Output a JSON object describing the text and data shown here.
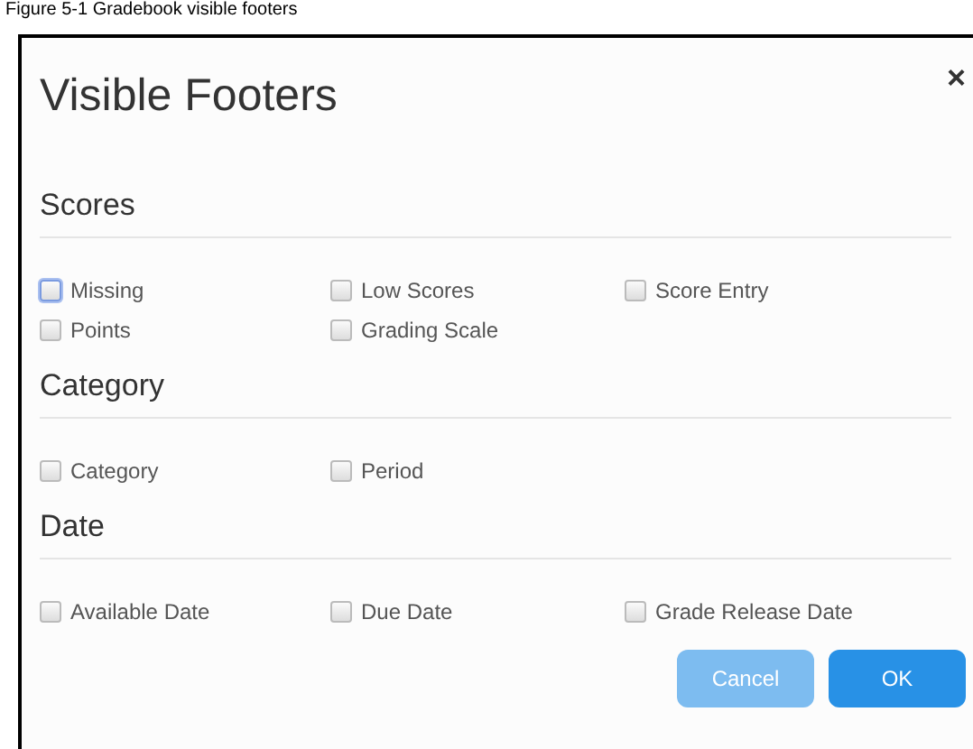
{
  "caption": "Figure 5-1 Gradebook visible footers",
  "dialog": {
    "title": "Visible Footers",
    "close": "×",
    "sections": [
      {
        "heading": "Scores",
        "options": [
          {
            "label": "Missing",
            "checked": false,
            "focused": true
          },
          {
            "label": "Low Scores",
            "checked": false,
            "focused": false
          },
          {
            "label": "Score Entry",
            "checked": false,
            "focused": false
          },
          {
            "label": "Points",
            "checked": false,
            "focused": false
          },
          {
            "label": "Grading Scale",
            "checked": false,
            "focused": false
          }
        ]
      },
      {
        "heading": "Category",
        "options": [
          {
            "label": "Category",
            "checked": false,
            "focused": false
          },
          {
            "label": "Period",
            "checked": false,
            "focused": false
          }
        ]
      },
      {
        "heading": "Date",
        "options": [
          {
            "label": "Available Date",
            "checked": false,
            "focused": false
          },
          {
            "label": "Due Date",
            "checked": false,
            "focused": false
          },
          {
            "label": "Grade Release Date",
            "checked": false,
            "focused": false
          }
        ]
      }
    ],
    "buttons": [
      {
        "label": "Cancel",
        "kind": "secondary"
      },
      {
        "label": "OK",
        "kind": "primary"
      }
    ]
  }
}
